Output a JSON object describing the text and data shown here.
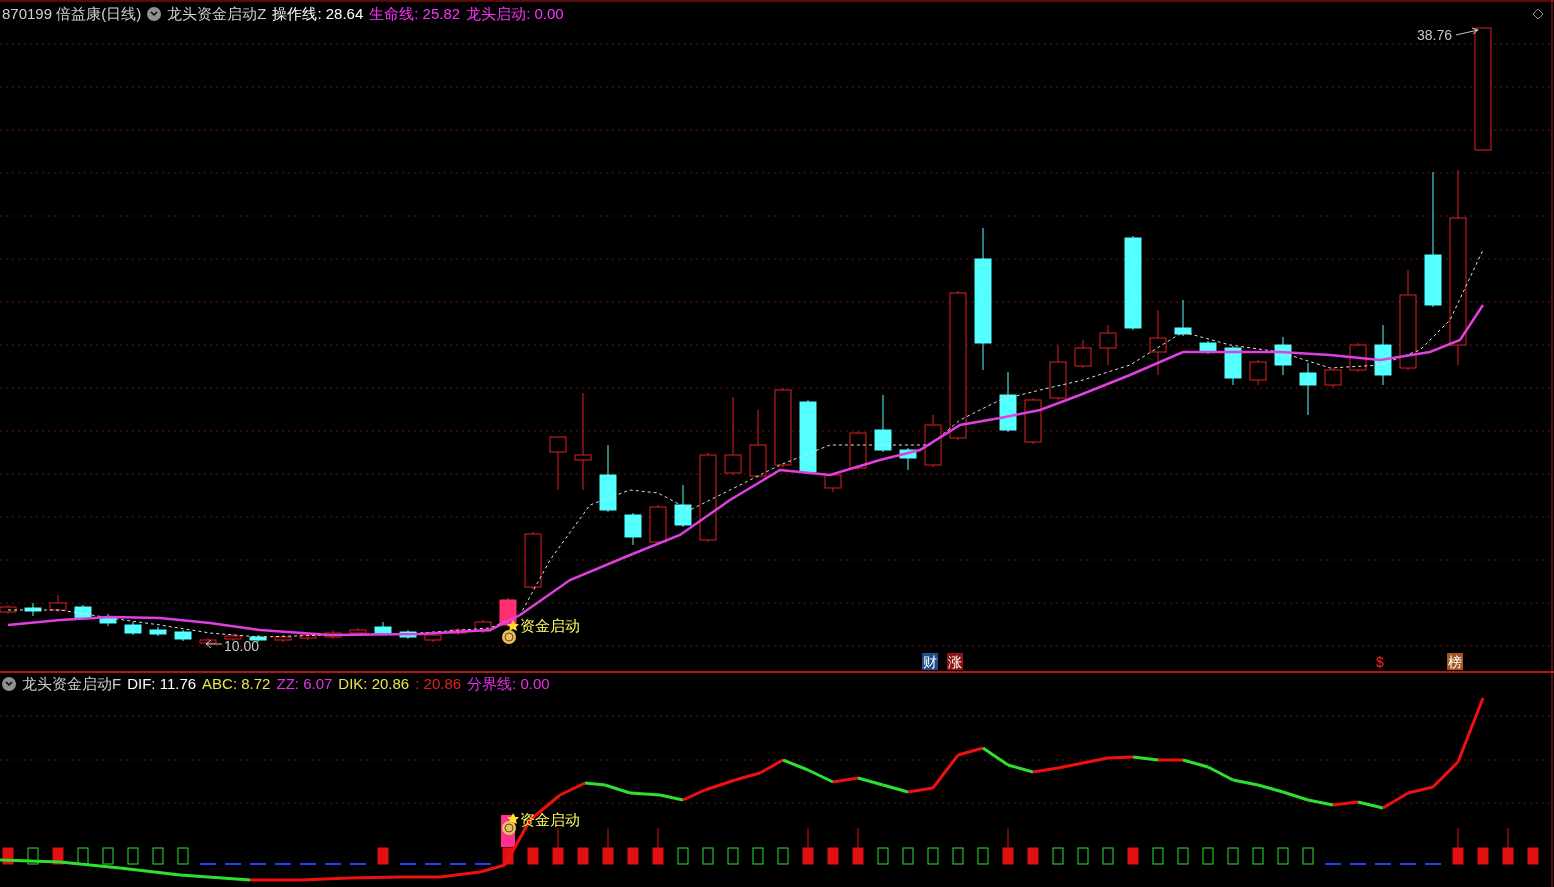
{
  "main_panel": {
    "legend": [
      {
        "text": "870199 倍益康(日线)",
        "color": "#d0d0d0"
      },
      {
        "text": "龙头资金启动Z",
        "color": "#d0d0d0"
      },
      {
        "text": "操作线: 28.64",
        "color": "#ffffff"
      },
      {
        "text": "生命线: 25.82",
        "color": "#ff33ff"
      },
      {
        "text": "龙头启动: 0.00",
        "color": "#ff33ff"
      }
    ],
    "high_label": "38.76",
    "low_label": "10.00",
    "signal_label": "资金启动",
    "markers": [
      {
        "text": "财",
        "color": "#1e4f8c"
      },
      {
        "text": "涨",
        "color": "#8c1414"
      },
      {
        "text": "$"
      },
      {
        "text": "榜",
        "color": "#a0581e"
      }
    ]
  },
  "indicator_panel": {
    "legend": [
      {
        "text": "龙头资金启动F",
        "color": "#d0d0d0"
      },
      {
        "text": "DIF: 11.76",
        "color": "#ffffff"
      },
      {
        "text": "ABC: 8.72",
        "color": "#e6e64a"
      },
      {
        "text": "ZZ: 6.07",
        "color": "#e633e6"
      },
      {
        "text": "DIK: 20.86",
        "color": "#e6e64a"
      },
      {
        "text": ": 20.86",
        "color": "#e62020"
      },
      {
        "text": "分界线: 0.00",
        "color": "#e633e6"
      }
    ],
    "signal_label": "资金启动"
  }
}
